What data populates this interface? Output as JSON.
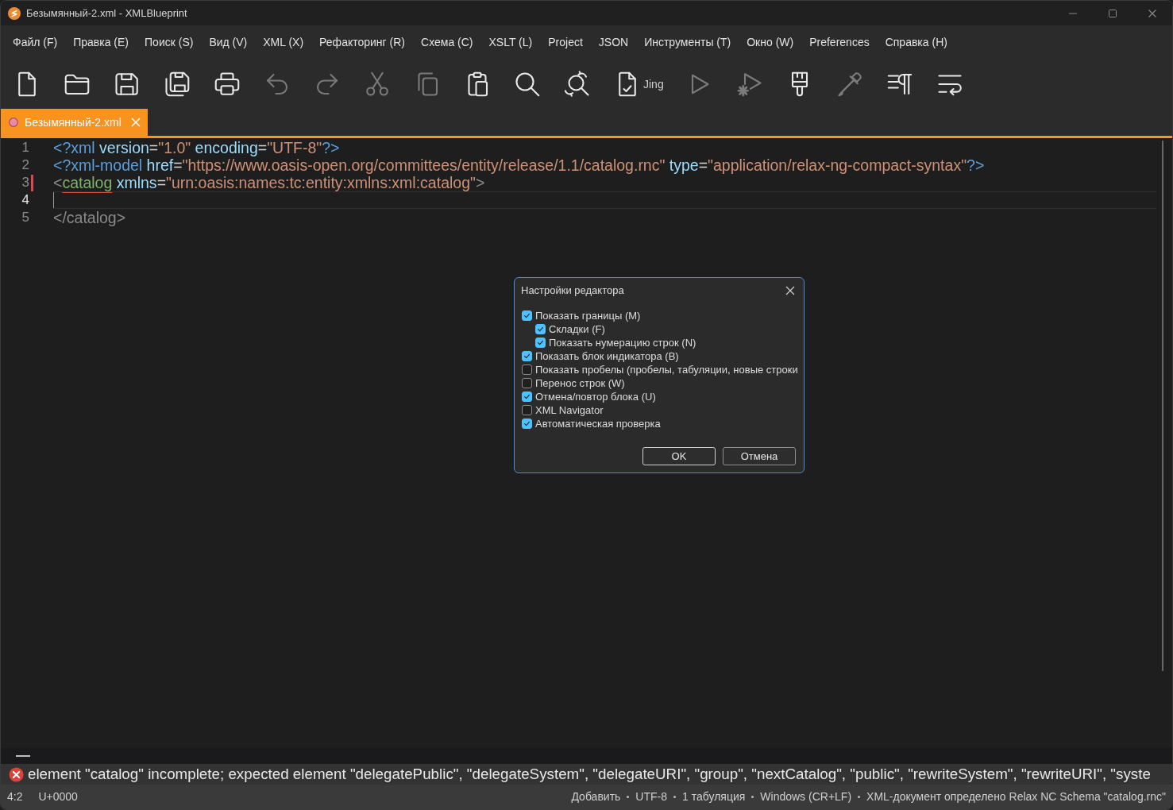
{
  "window": {
    "title": "Безымянный-2.xml - XMLBlueprint"
  },
  "menu": [
    "Файл (F)",
    "Правка (E)",
    "Поиск (S)",
    "Вид (V)",
    "XML (X)",
    "Рефакторинг (R)",
    "Схема (C)",
    "XSLT (L)",
    "Project",
    "JSON",
    "Инструменты (T)",
    "Окно (W)",
    "Preferences",
    "Справка (H)"
  ],
  "toolbar": [
    {
      "kind": "new",
      "disabled": false
    },
    {
      "kind": "open",
      "disabled": false
    },
    {
      "kind": "save",
      "disabled": false
    },
    {
      "kind": "saveall",
      "disabled": false
    },
    {
      "kind": "print",
      "disabled": false
    },
    {
      "kind": "undo",
      "disabled": true
    },
    {
      "kind": "redo",
      "disabled": true
    },
    {
      "kind": "cut",
      "disabled": true
    },
    {
      "kind": "copy",
      "disabled": true
    },
    {
      "kind": "paste",
      "disabled": false
    },
    {
      "kind": "find",
      "disabled": false
    },
    {
      "kind": "replace",
      "disabled": false
    },
    {
      "kind": "validate",
      "label": "Jing",
      "disabled": false
    },
    {
      "kind": "run",
      "disabled": true
    },
    {
      "kind": "runsettings",
      "disabled": true
    },
    {
      "kind": "brush",
      "disabled": false
    },
    {
      "kind": "eyedropper",
      "disabled": true
    },
    {
      "kind": "format",
      "disabled": false
    },
    {
      "kind": "wrap",
      "disabled": false
    }
  ],
  "tabs": [
    {
      "label": "Безымянный-2.xml",
      "selected": true,
      "modified": true
    }
  ],
  "editor": {
    "lines": [
      {
        "number": "1",
        "current": false,
        "error": false,
        "tokens": [
          {
            "kind": "pi",
            "text": "<?xml",
            "error": false
          },
          {
            "kind": "attr",
            "text": " version",
            "error": false
          },
          {
            "kind": "eq",
            "text": "=",
            "error": false
          },
          {
            "kind": "value",
            "text": "\"1.0\"",
            "error": false
          },
          {
            "kind": "attr",
            "text": " encoding",
            "error": false
          },
          {
            "kind": "eq",
            "text": "=",
            "error": false
          },
          {
            "kind": "value",
            "text": "\"UTF-8\"",
            "error": false
          },
          {
            "kind": "pi",
            "text": "?>",
            "error": false
          }
        ]
      },
      {
        "number": "2",
        "current": false,
        "error": false,
        "tokens": [
          {
            "kind": "pi",
            "text": "<?xml-model",
            "error": false
          },
          {
            "kind": "attr",
            "text": " href",
            "error": false
          },
          {
            "kind": "eq",
            "text": "=",
            "error": false
          },
          {
            "kind": "value",
            "text": "\"https://www.oasis-open.org/committees/entity/release/1.1/catalog.rnc\"",
            "error": false
          },
          {
            "kind": "attr",
            "text": " type",
            "error": false
          },
          {
            "kind": "eq",
            "text": "=",
            "error": false
          },
          {
            "kind": "value",
            "text": "\"application/relax-ng-compact-syntax\"",
            "error": false
          },
          {
            "kind": "pi",
            "text": "?>",
            "error": false
          }
        ]
      },
      {
        "number": "3",
        "current": false,
        "error": true,
        "tokens": [
          {
            "kind": "markup",
            "text": "<",
            "error": false
          },
          {
            "kind": "element",
            "text": "catalog",
            "error": true
          },
          {
            "kind": "attr",
            "text": " xmlns",
            "error": false
          },
          {
            "kind": "eq",
            "text": "=",
            "error": false
          },
          {
            "kind": "value",
            "text": "\"urn:oasis:names:tc:entity:xmlns:xml:catalog\"",
            "error": false
          },
          {
            "kind": "markup",
            "text": ">",
            "error": false
          }
        ]
      },
      {
        "number": "4",
        "current": true,
        "error": false
      },
      {
        "number": "5",
        "current": false,
        "error": false,
        "tokens": [
          {
            "kind": "markup",
            "text": "</catalog>",
            "error": false
          }
        ]
      }
    ]
  },
  "dialog": {
    "title": "Настройки редактора",
    "options": [
      {
        "label": "Показать границы (M)",
        "checked": true,
        "children": [
          {
            "label": "Складки (F)",
            "checked": true
          },
          {
            "label": "Показать нумерацию строк (N)",
            "checked": true
          }
        ]
      },
      {
        "label": "Показать блок индикатора (B)",
        "checked": true
      },
      {
        "label": "Показать пробелы (пробелы, табуляции, новые строки",
        "checked": false
      },
      {
        "label": "Перенос строк (W)",
        "checked": false
      },
      {
        "label": "Отмена/повтор блока (U)",
        "checked": true
      },
      {
        "label": "XML Navigator",
        "checked": false
      },
      {
        "label": "Автоматическая проверка",
        "checked": true
      }
    ],
    "buttons": [
      {
        "label": "OK",
        "default": true
      },
      {
        "label": "Отмена",
        "default": false
      }
    ]
  },
  "error_bar": {
    "message": "element \"catalog\" incomplete; expected element \"delegatePublic\", \"delegateSystem\", \"delegateURI\", \"group\", \"nextCatalog\", \"public\", \"rewriteSystem\", \"rewriteURI\", \"syste"
  },
  "status_bar": {
    "position": "4:2",
    "character": "U+0000",
    "items": [
      "Добавить",
      "UTF-8",
      "1 табуляция",
      "Windows (CR+LF)",
      "XML-документ определено Relax NC Schema \"catalog.rnc\""
    ]
  }
}
